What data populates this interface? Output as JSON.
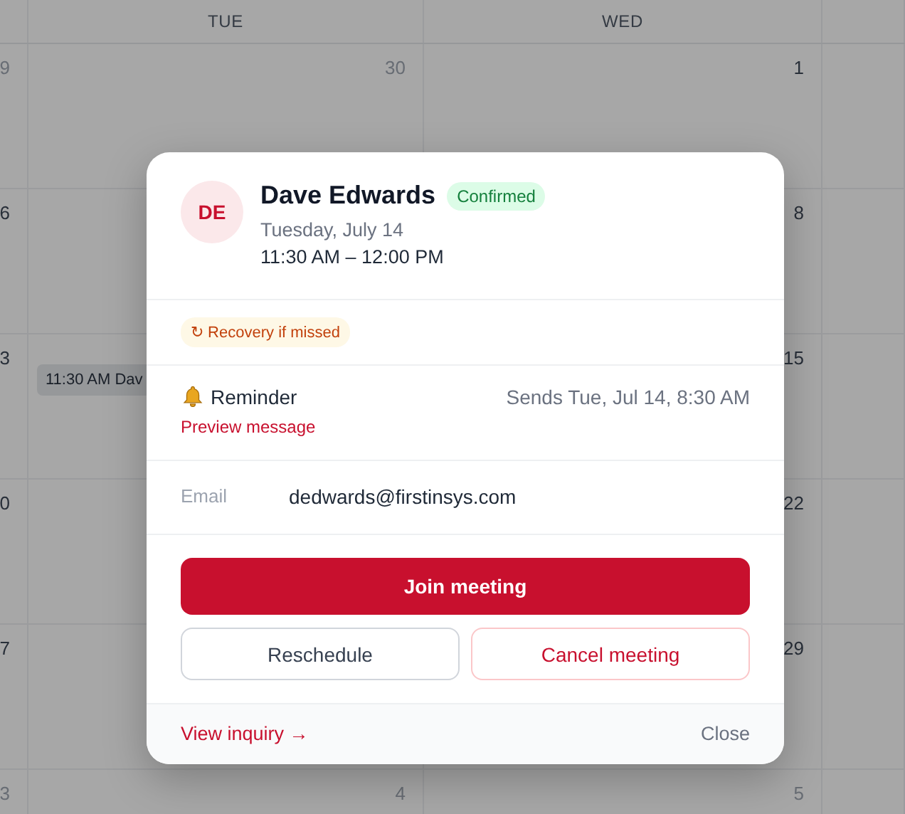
{
  "calendar": {
    "headers": {
      "tue": "TUE",
      "wed": "WED"
    },
    "weeks": [
      {
        "column_1": {
          "number": "9",
          "muted": true
        },
        "tue": {
          "number": "30",
          "muted": true
        },
        "wed": {
          "number": "1",
          "muted": false
        }
      },
      {
        "column_1": {
          "number": "6",
          "muted": false
        },
        "wed": {
          "number": "8",
          "muted": false
        }
      },
      {
        "column_1": {
          "number": "3",
          "muted": false
        },
        "tue": {
          "event": "11:30 AM Dav"
        },
        "wed": {
          "number": "15",
          "muted": false
        }
      },
      {
        "column_1": {
          "number": "0",
          "muted": false
        },
        "wed": {
          "number": "22",
          "muted": false
        }
      },
      {
        "column_1": {
          "number": "7",
          "muted": false
        },
        "wed": {
          "number": "29",
          "muted": false
        }
      },
      {
        "column_1": {
          "number": "3",
          "muted": true
        },
        "tue": {
          "number": "4",
          "muted": true
        },
        "wed": {
          "number": "5",
          "muted": true
        }
      }
    ]
  },
  "popover": {
    "avatar": "DE",
    "name": "Dave Edwards",
    "status": "Confirmed",
    "date": "Tuesday, July 14",
    "time": "11:30 AM – 12:00 PM",
    "tags": [
      {
        "label": "↻ Recovery if missed",
        "kind": "warning"
      }
    ],
    "reminder": {
      "label": "Reminder",
      "schedule": "Sends Tue, Jul 14, 8:30 AM",
      "link": "Preview message"
    },
    "fields": [
      {
        "label": "Email",
        "value": "dedwards@firstinsys.com"
      }
    ],
    "buttons": [
      {
        "label": "Join meeting",
        "kind": "primary"
      },
      {
        "label": "Reschedule",
        "kind": "secondary"
      },
      {
        "label": "Cancel meeting",
        "kind": "danger"
      }
    ],
    "footer": {
      "link": "View inquiry →",
      "close": "Close"
    }
  }
}
